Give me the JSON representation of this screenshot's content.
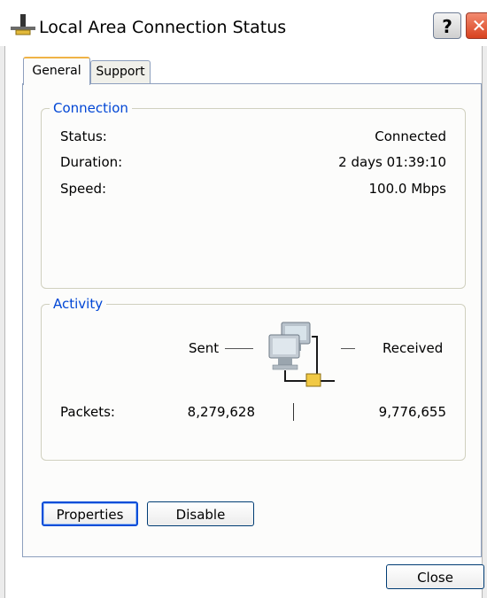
{
  "window": {
    "title": "Local Area Connection Status",
    "help_glyph": "?",
    "close_glyph": "✕"
  },
  "tabs": [
    {
      "label": "General",
      "active": true
    },
    {
      "label": "Support",
      "active": false
    }
  ],
  "connection": {
    "legend": "Connection",
    "rows": [
      {
        "label": "Status:",
        "value": "Connected"
      },
      {
        "label": "Duration:",
        "value": "2 days 01:39:10"
      },
      {
        "label": "Speed:",
        "value": "100.0 Mbps"
      }
    ]
  },
  "activity": {
    "legend": "Activity",
    "sent_label": "Sent",
    "received_label": "Received",
    "packets_label": "Packets:",
    "packets_sent": "8,279,628",
    "packets_received": "9,776,655"
  },
  "buttons": {
    "properties": "Properties",
    "disable": "Disable",
    "close": "Close"
  },
  "colors": {
    "legend_text": "#0046d5",
    "focus_border": "#0a4dd8",
    "close_button": "#d8421f"
  }
}
